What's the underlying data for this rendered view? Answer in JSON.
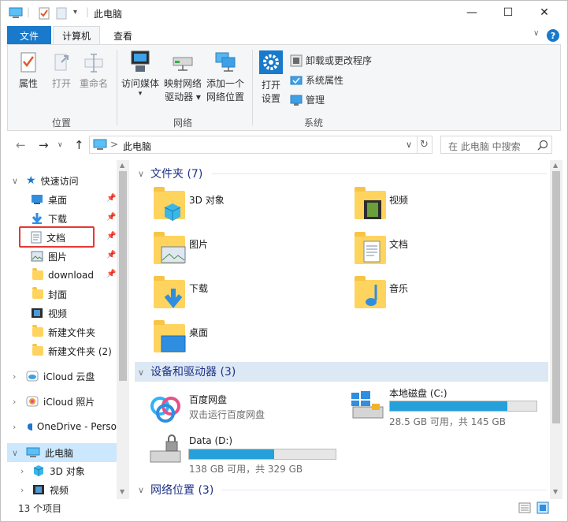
{
  "window": {
    "title": "此电脑",
    "controls": {
      "minimize": "—",
      "maximize": "☐",
      "close": "✕"
    }
  },
  "ribbon_tabs": {
    "file": "文件",
    "computer": "计算机",
    "view": "查看",
    "help": "?"
  },
  "ribbon": {
    "location_group": {
      "label": "位置",
      "properties": "属性",
      "open": "打开",
      "rename": "重命名"
    },
    "network_group": {
      "label": "网络",
      "media_line1": "访问媒体",
      "media_line2": "▾",
      "map_line1": "映射网络",
      "map_line2": "驱动器 ▾",
      "add_line1": "添加一个",
      "add_line2": "网络位置"
    },
    "system_group": {
      "label": "系统",
      "settings_line1": "打开",
      "settings_line2": "设置",
      "uninstall": "卸载或更改程序",
      "system_props": "系统属性",
      "manage": "管理"
    }
  },
  "address_bar": {
    "back": "←",
    "forward": "→",
    "up": "↑",
    "separator": ">",
    "path": "此电脑",
    "dropdown": "∨",
    "refresh": "↻",
    "search_placeholder": "在 此电脑 中搜索"
  },
  "nav": {
    "quick_access": "快速访问",
    "items": [
      {
        "label": "桌面",
        "pinned": true
      },
      {
        "label": "下载",
        "pinned": true
      },
      {
        "label": "文档",
        "pinned": true
      },
      {
        "label": "图片",
        "pinned": true
      },
      {
        "label": "download",
        "pinned": true
      },
      {
        "label": "封面",
        "pinned": false
      },
      {
        "label": "视频",
        "pinned": false
      },
      {
        "label": "新建文件夹",
        "pinned": false
      },
      {
        "label": "新建文件夹 (2)",
        "pinned": false
      }
    ],
    "icloud_drive": "iCloud 云盘",
    "icloud_photos": "iCloud 照片",
    "onedrive": "OneDrive - Perso",
    "this_pc": "此电脑",
    "this_pc_children": [
      "3D 对象",
      "视频"
    ]
  },
  "main": {
    "folders_header": "文件夹 (7)",
    "folders": [
      "3D 对象",
      "视频",
      "图片",
      "文档",
      "下载",
      "音乐",
      "桌面"
    ],
    "devices_header": "设备和驱动器 (3)",
    "baidu": {
      "name": "百度网盘",
      "sub": "双击运行百度网盘"
    },
    "drive_c": {
      "name": "本地磁盘 (C:)",
      "free_text": "28.5 GB 可用，共 145 GB",
      "used_fraction": 0.803
    },
    "drive_d": {
      "name": "Data (D:)",
      "free_text": "138 GB 可用，共 329 GB",
      "used_fraction": 0.58
    },
    "network_header": "网络位置 (3)"
  },
  "status_bar": {
    "count": "13 个项目"
  },
  "colors": {
    "accent": "#1979ca",
    "selection": "#cce8ff",
    "bar": "#26a0da",
    "highlight_box": "#e53935"
  }
}
